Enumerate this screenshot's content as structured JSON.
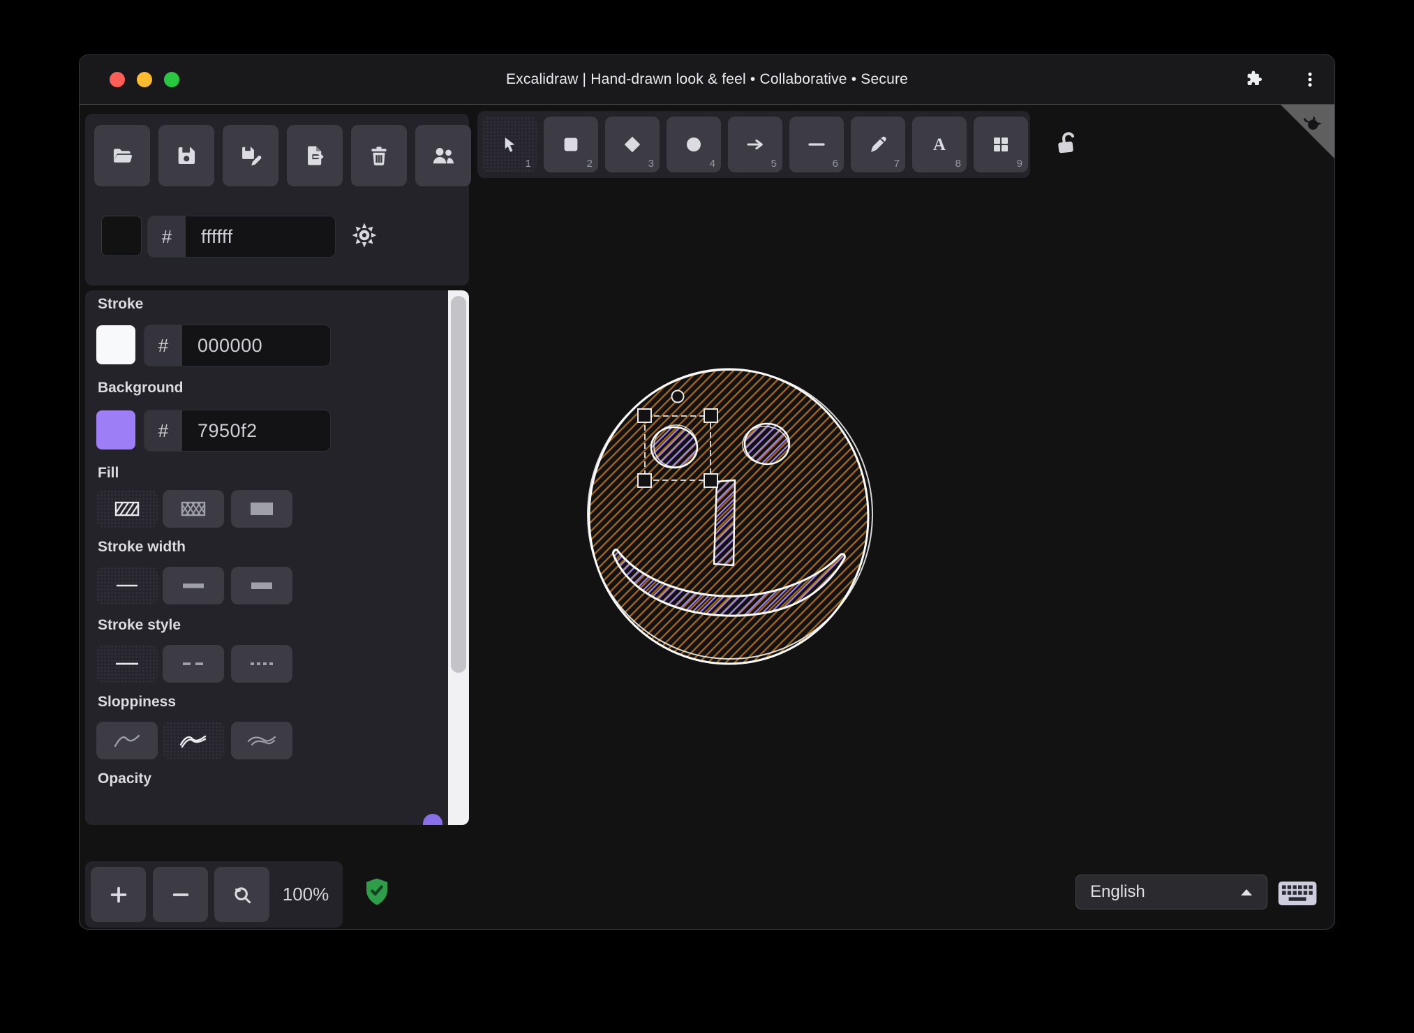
{
  "title_bar": {
    "title": "Excalidraw | Hand-drawn look & feel • Collaborative • Secure"
  },
  "file_actions": [
    {
      "name": "open-file"
    },
    {
      "name": "save-file"
    },
    {
      "name": "save-as"
    },
    {
      "name": "export-image"
    },
    {
      "name": "clear-canvas"
    },
    {
      "name": "collaboration"
    }
  ],
  "canvas_background": {
    "hash": "#",
    "hex": "ffffff"
  },
  "tools": [
    {
      "name": "selection",
      "shortcut": "1",
      "selected": true
    },
    {
      "name": "rectangle",
      "shortcut": "2",
      "selected": false
    },
    {
      "name": "diamond",
      "shortcut": "3",
      "selected": false
    },
    {
      "name": "ellipse",
      "shortcut": "4",
      "selected": false
    },
    {
      "name": "arrow",
      "shortcut": "5",
      "selected": false
    },
    {
      "name": "line",
      "shortcut": "6",
      "selected": false
    },
    {
      "name": "draw",
      "shortcut": "7",
      "selected": false
    },
    {
      "name": "text",
      "shortcut": "8",
      "selected": false
    },
    {
      "name": "library",
      "shortcut": "9",
      "selected": false
    }
  ],
  "properties": {
    "stroke": {
      "label": "Stroke",
      "hash": "#",
      "hex": "000000",
      "swatch": "#f8f9fa"
    },
    "background": {
      "label": "Background",
      "hash": "#",
      "hex": "7950f2",
      "swatch": "#9d7ef7"
    },
    "fill": {
      "label": "Fill",
      "options": [
        "hachure",
        "cross-hatch",
        "solid"
      ],
      "selected": "hachure"
    },
    "stroke_width": {
      "label": "Stroke width",
      "options": [
        "thin",
        "bold",
        "extra-bold"
      ],
      "selected": "thin"
    },
    "stroke_style": {
      "label": "Stroke style",
      "options": [
        "solid",
        "dashed",
        "dotted"
      ],
      "selected": "solid"
    },
    "sloppiness": {
      "label": "Sloppiness",
      "options": [
        "architect",
        "artist",
        "cartoonist"
      ],
      "selected": "artist"
    },
    "opacity": {
      "label": "Opacity"
    }
  },
  "footer": {
    "zoom_level": "100%",
    "language": {
      "value": "English"
    }
  },
  "canvas": {
    "description": "hand-drawn smiley face with hachure fill, left eye selected",
    "hachure_orange": "#a9690e",
    "hachure_purple": "#9f86f0",
    "stroke_white": "#fbfbfb"
  }
}
